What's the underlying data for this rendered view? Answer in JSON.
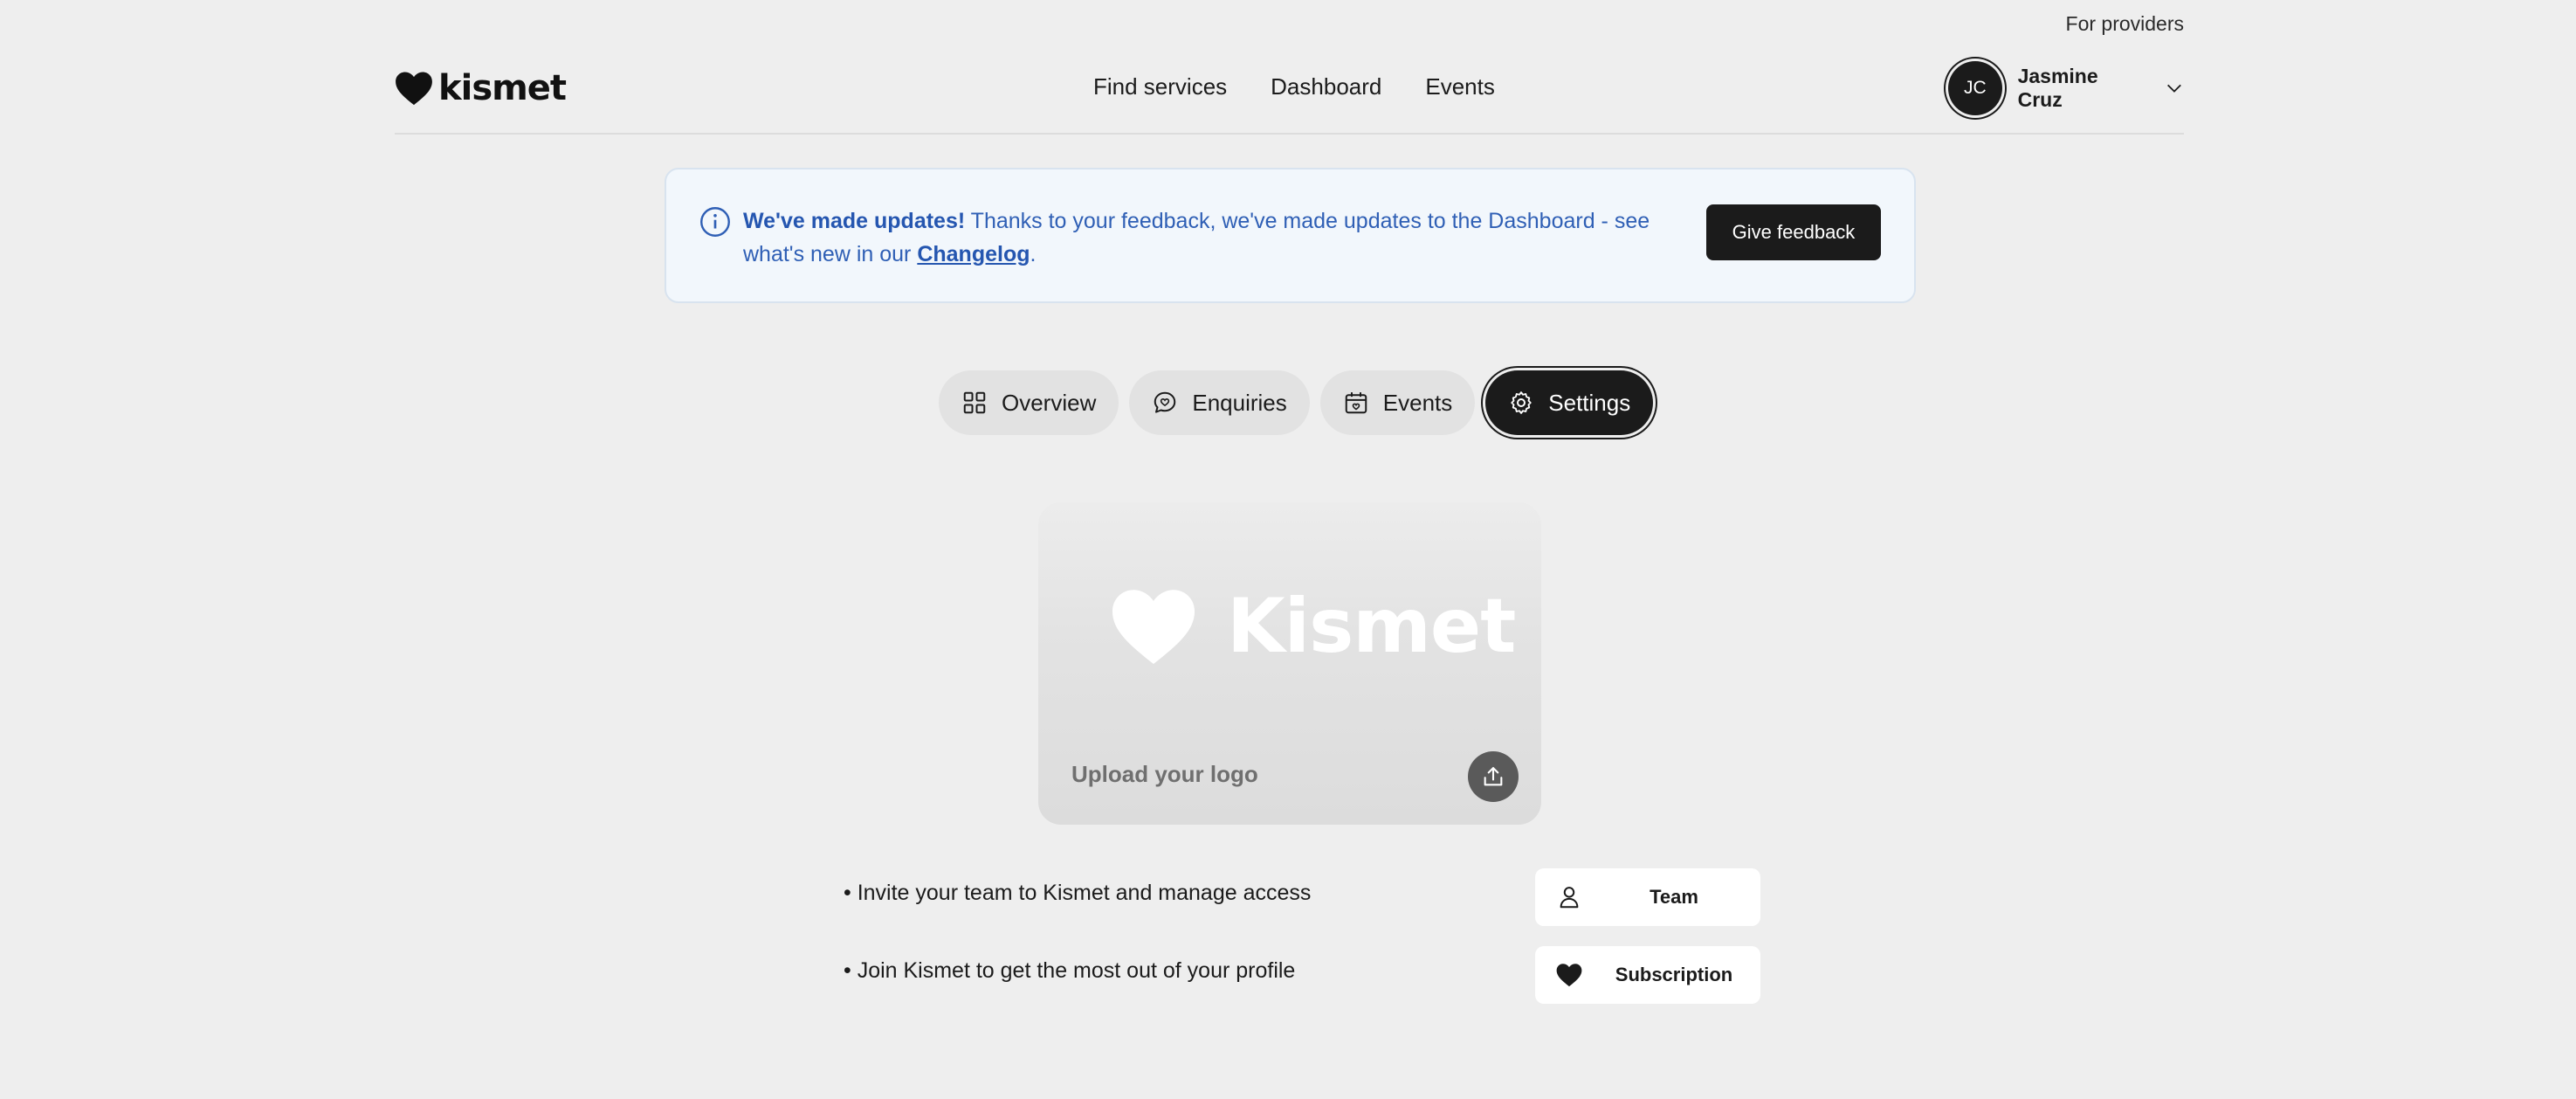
{
  "top_link": {
    "for_providers": "For providers"
  },
  "header": {
    "logo_text": "kismet",
    "nav": [
      {
        "label": "Find services"
      },
      {
        "label": "Dashboard"
      },
      {
        "label": "Events"
      }
    ],
    "user": {
      "initials": "JC",
      "name": "Jasmine Cruz"
    }
  },
  "banner": {
    "headline": "We've made updates!",
    "body": " Thanks to your feedback, we've made updates to the Dashboard - see what's new in our ",
    "link_label": "Changelog",
    "suffix": ".",
    "button_label": "Give feedback"
  },
  "tabs": [
    {
      "label": "Overview",
      "icon": "grid-icon",
      "active": false
    },
    {
      "label": "Enquiries",
      "icon": "chat-icon",
      "active": false
    },
    {
      "label": "Events",
      "icon": "calendar-heart-icon",
      "active": false
    },
    {
      "label": "Settings",
      "icon": "gear-icon",
      "active": true
    }
  ],
  "logo_card": {
    "placeholder_brand": "Kismet",
    "upload_label": "Upload your logo"
  },
  "settings": [
    {
      "text": "• Invite your team to Kismet and manage access",
      "button_label": "Team",
      "icon": "person-icon"
    },
    {
      "text": "• Join Kismet to get the most out of your profile",
      "button_label": "Subscription",
      "icon": "heart-icon"
    }
  ],
  "colors": {
    "background": "#eeeeee",
    "dark": "#1b1b1b",
    "banner_bg": "#f2f7fc",
    "banner_text": "#2f5fb5"
  }
}
